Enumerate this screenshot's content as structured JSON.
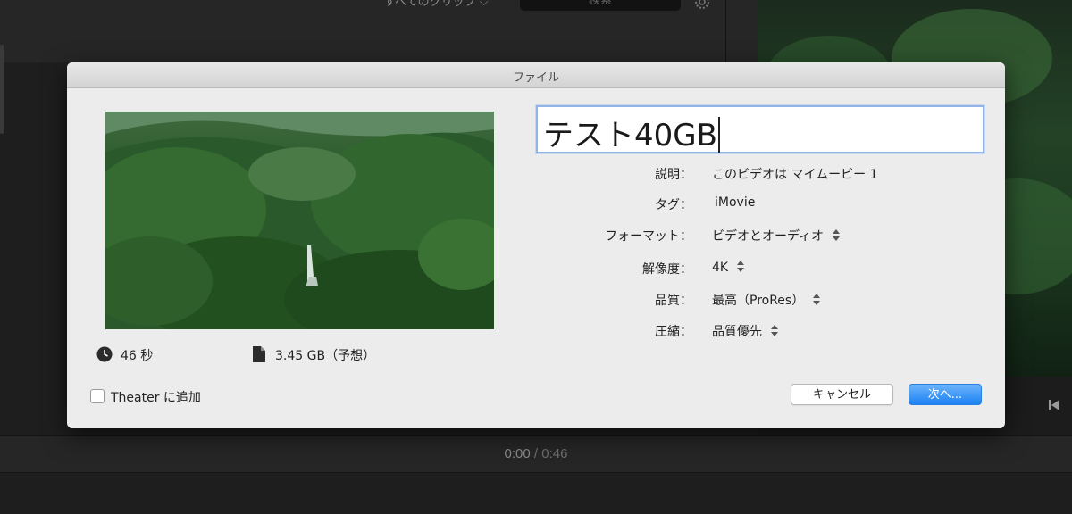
{
  "background": {
    "top_label": "すべてのクリップ ⌵",
    "search_placeholder": "検索",
    "timecode_current": "0:00",
    "timecode_separator": "/",
    "timecode_total": "0:46"
  },
  "dialog": {
    "title": "ファイル",
    "name_value": "テスト40GB",
    "duration": "46 秒",
    "file_size": "3.45 GB（予想）",
    "fields": [
      {
        "label": "説明：",
        "value": "このビデオは マイムービー 1",
        "stepper": false
      },
      {
        "label": "タグ：",
        "value": "iMovie",
        "stepper": false
      },
      {
        "label": "フォーマット：",
        "value": "ビデオとオーディオ",
        "stepper": true
      },
      {
        "label": "解像度：",
        "value": "4K",
        "stepper": true
      },
      {
        "label": "品質：",
        "value": "最高（ProRes）",
        "stepper": true
      },
      {
        "label": "圧縮：",
        "value": "品質優先",
        "stepper": true
      }
    ],
    "theater_label": "Theater に追加",
    "theater_checked": false,
    "cancel_label": "キャンセル",
    "next_label": "次へ..."
  },
  "colors": {
    "accent": "#1c82f4",
    "dialog_bg": "#ececec",
    "app_bg": "#1e1e1f"
  }
}
